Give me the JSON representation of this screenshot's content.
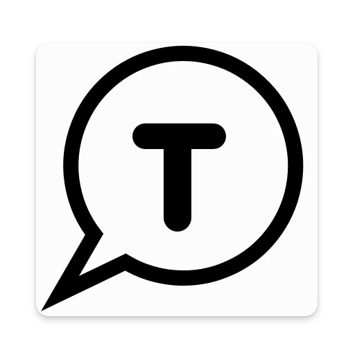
{
  "app_icon": {
    "icon": "speech-bubble-t-icon",
    "glyph": "T",
    "colors": {
      "tile_background": "#fcfcfc",
      "stroke": "#000000",
      "page_background": "#ffffff"
    }
  }
}
